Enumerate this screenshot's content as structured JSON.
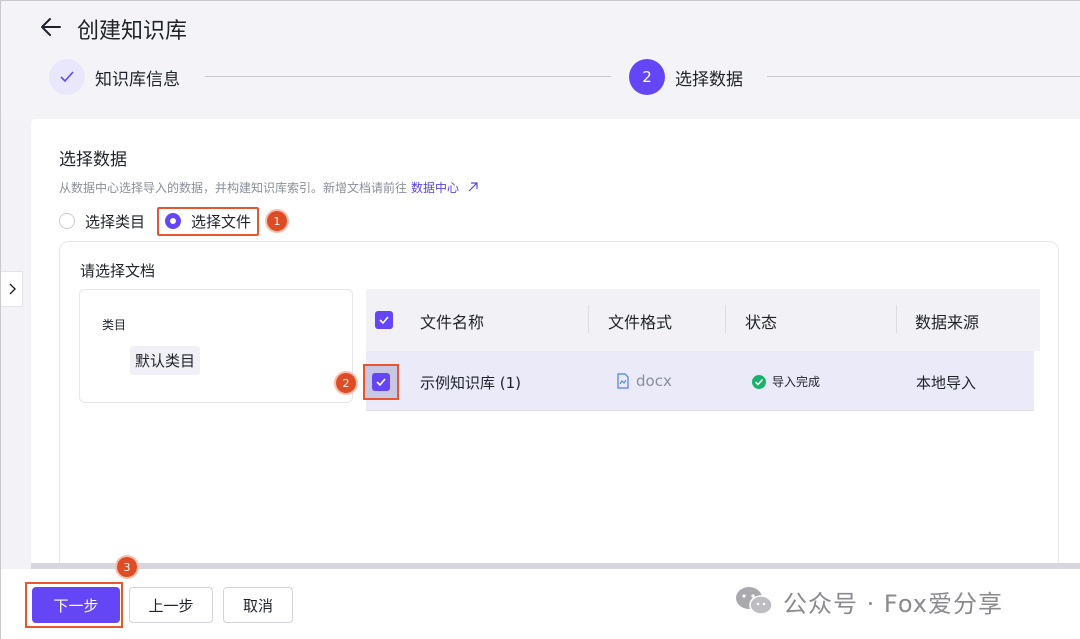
{
  "header": {
    "title": "创建知识库",
    "steps": [
      {
        "label": "知识库信息",
        "state": "done"
      },
      {
        "number": "2",
        "label": "选择数据",
        "state": "active"
      }
    ]
  },
  "section": {
    "title": "选择数据",
    "description": "从数据中心选择导入的数据，并构建知识库索引。新增文档请前往",
    "link_text": "数据中心"
  },
  "radio": {
    "options": [
      "选择类目",
      "选择文件"
    ],
    "selected": "选择文件"
  },
  "doc_select": {
    "title": "请选择文档",
    "category_label": "类目",
    "category_item": "默认类目"
  },
  "table": {
    "columns": [
      "文件名称",
      "文件格式",
      "状态",
      "数据来源"
    ],
    "rows": [
      {
        "name": "示例知识库 (1)",
        "format": "docx",
        "status": "导入完成",
        "source": "本地导入",
        "checked": true
      }
    ]
  },
  "footer": {
    "next_label": "下一步",
    "prev_label": "上一步",
    "cancel_label": "取消"
  },
  "annotations": {
    "badge1": "1",
    "badge2": "2",
    "badge3": "3"
  },
  "watermark": "公众号 · Fox爱分享",
  "colors": {
    "accent": "#6446f6",
    "highlight": "#e8552f",
    "success": "#19b26b"
  }
}
